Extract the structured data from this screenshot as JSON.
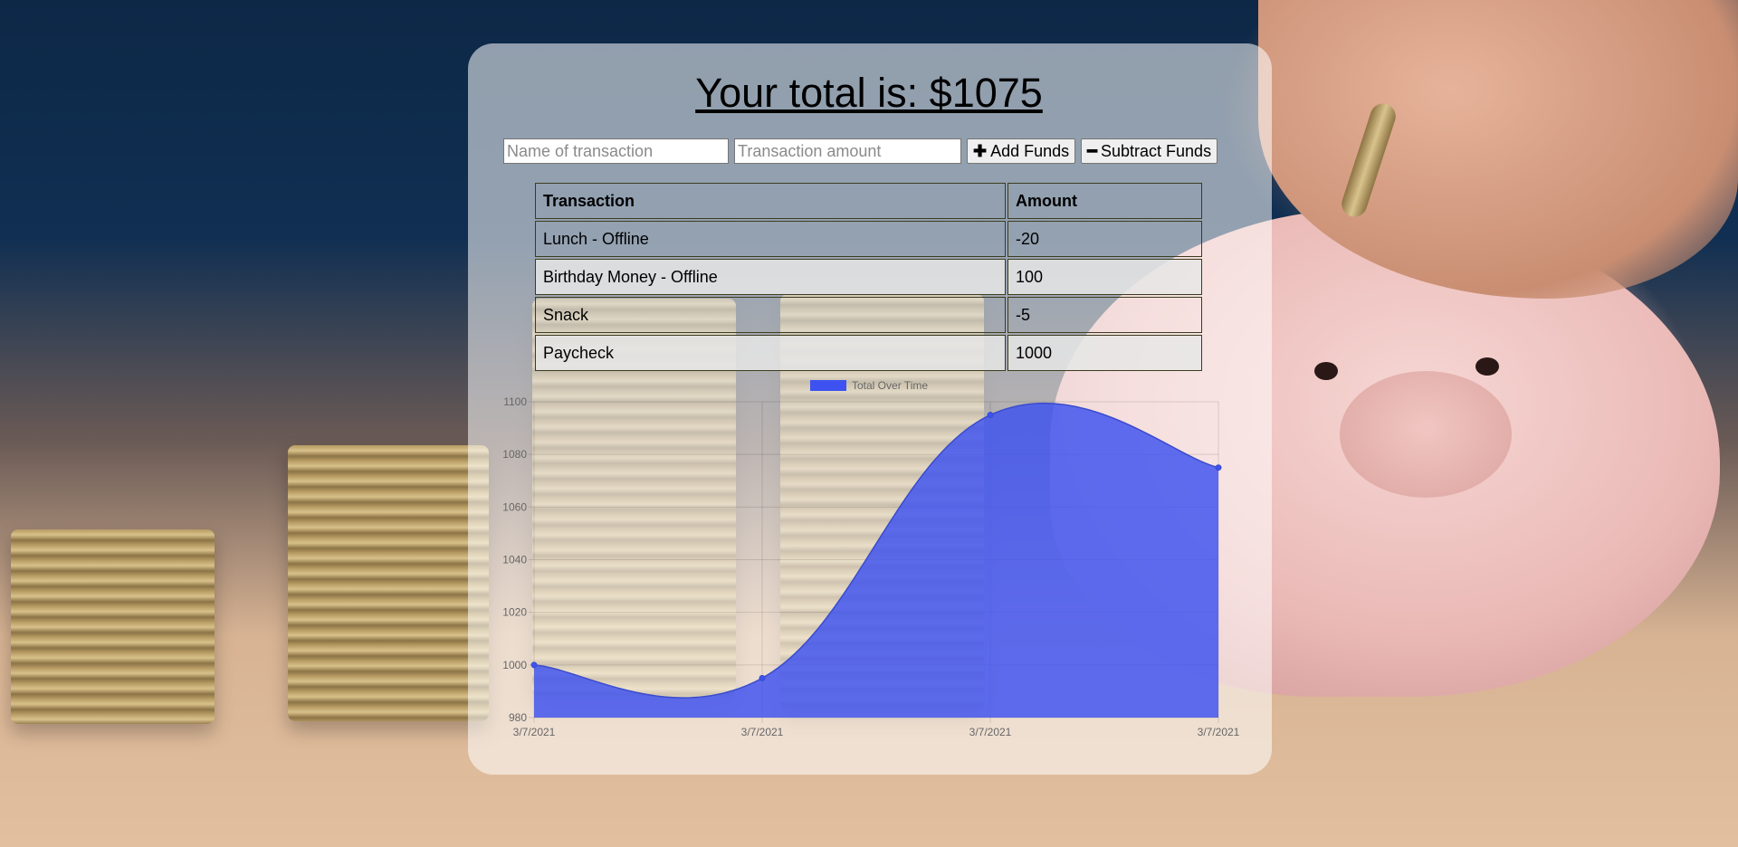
{
  "header": {
    "total_label": "Your total is: $1075"
  },
  "form": {
    "name_placeholder": "Name of transaction",
    "amount_placeholder": "Transaction amount",
    "add_label": "Add Funds",
    "subtract_label": "Subtract Funds",
    "add_icon": "plus-icon",
    "subtract_icon": "minus-icon"
  },
  "table": {
    "headers": [
      "Transaction",
      "Amount"
    ],
    "rows": [
      {
        "name": "Lunch - Offline",
        "amount": "-20"
      },
      {
        "name": "Birthday Money - Offline",
        "amount": "100"
      },
      {
        "name": "Snack",
        "amount": "-5"
      },
      {
        "name": "Paycheck",
        "amount": "1000"
      }
    ]
  },
  "colors": {
    "series_fill": "#3d52f0",
    "series_fill_alpha": "rgba(60,80,240,0.82)",
    "series_line": "#3a4ccc",
    "grid": "rgba(0,0,0,0.12)"
  },
  "chart_data": {
    "type": "area",
    "x": [
      "3/7/2021",
      "3/7/2021",
      "3/7/2021",
      "3/7/2021"
    ],
    "series": [
      {
        "name": "Total Over Time",
        "values": [
          1000,
          995,
          1095,
          1075
        ]
      }
    ],
    "ylim": [
      980,
      1100
    ],
    "yticks": [
      980,
      1000,
      1020,
      1040,
      1060,
      1080,
      1100
    ],
    "grid": true,
    "legend": "top-center",
    "curve": "smooth"
  }
}
